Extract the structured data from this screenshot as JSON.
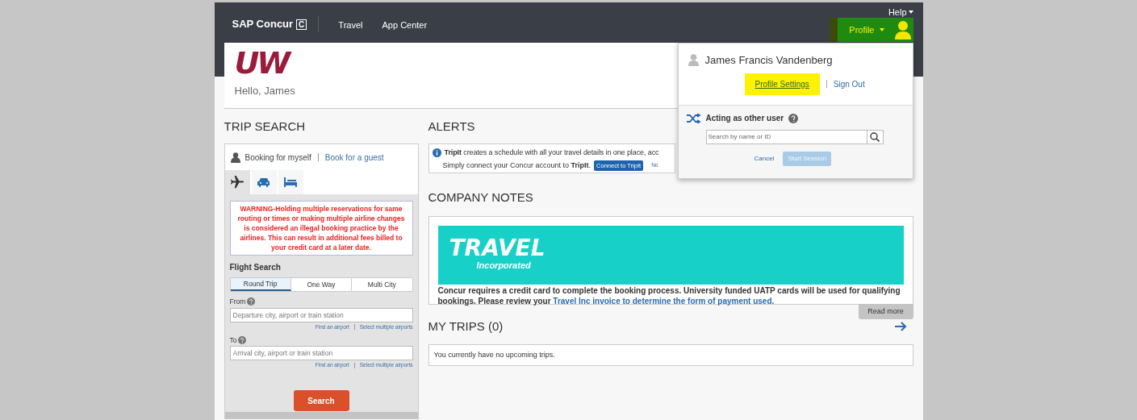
{
  "header": {
    "brand": "SAP Concur",
    "brand_mark": "C",
    "nav": [
      {
        "label": "Travel"
      },
      {
        "label": "App Center"
      }
    ],
    "help": "Help",
    "profile": {
      "label": "Profile",
      "highlighted": true
    }
  },
  "welcome": {
    "logo": "UW",
    "greeting": "Hello, James"
  },
  "trip_search": {
    "title": "TRIP SEARCH",
    "booking_for": "Booking for myself",
    "guest_link": "Book for a guest",
    "modes": [
      {
        "kind": "flight",
        "selected": true
      },
      {
        "kind": "car",
        "selected": false
      },
      {
        "kind": "hotel",
        "selected": false
      }
    ],
    "warning": "WARNING-Holding multiple reservations for same routing or times or making multiple airline changes is considered an illegal booking practice by the airlines. This can result in additional fees billed to your credit card at a later date.",
    "flight_search": {
      "title": "Flight Search",
      "trip_types": [
        {
          "label": "Round Trip",
          "selected": true
        },
        {
          "label": "One Way",
          "selected": false
        },
        {
          "label": "Multi City",
          "selected": false
        }
      ],
      "fields": [
        {
          "label": "From",
          "placeholder": "Departure city, airport or train station",
          "links": [
            "Find an airport",
            "Select multiple airports"
          ]
        },
        {
          "label": "To",
          "placeholder": "Arrival city, airport or train station",
          "links": [
            "Find an airport",
            "Select multiple airports"
          ]
        }
      ],
      "search_button": "Search"
    }
  },
  "alerts": {
    "title": "ALERTS",
    "line_1": "**TripIt** creates a schedule with all your travel details in one place, acc",
    "line_2": "Simply connect your Concur account to **TripIt**.",
    "button": "Connect to TripIt",
    "link": "No"
  },
  "company_notes": {
    "title": "COMPANY NOTES",
    "banner_title": "TRAVEL",
    "banner_subtitle": "Incorporated",
    "text": "Concur requires a credit card to complete the booking process. University funded UATP cards will be used for qualifying bookings. Please review your",
    "link": "Travel Inc invoice to determine the form of payment used.",
    "read_more": "Read more"
  },
  "my_trips": {
    "title": "MY TRIPS (0)",
    "empty": "You currently have no upcoming trips."
  },
  "profile_menu": {
    "name": "James Francis Vandenberg",
    "links": [
      {
        "label": "Profile Settings",
        "highlighted": true
      },
      {
        "label": "Sign Out",
        "highlighted": false
      }
    ],
    "acting_title": "Acting as other user",
    "search_placeholder": "Search by name or ID",
    "cancel": "Cancel",
    "start": {
      "label": "Start Session",
      "disabled": true
    }
  }
}
